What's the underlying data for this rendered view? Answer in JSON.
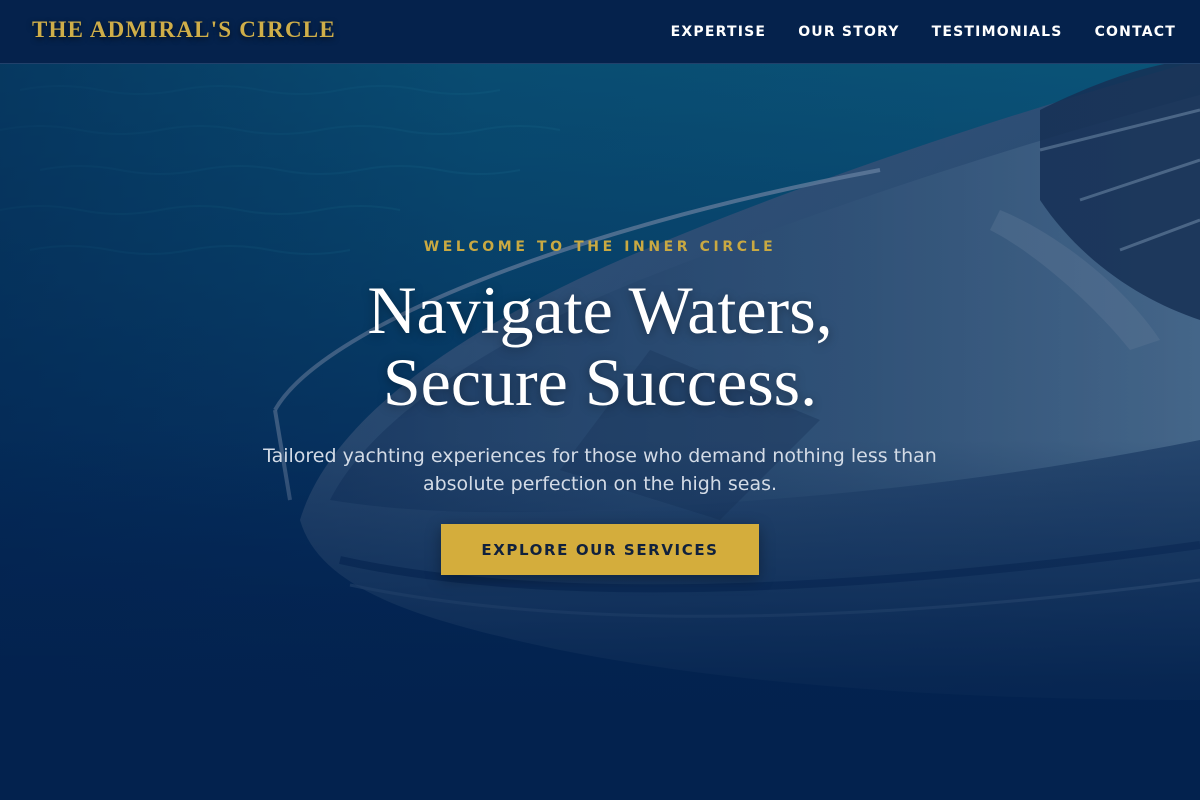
{
  "brand": {
    "name": "THE ADMIRAL'S CIRCLE"
  },
  "nav": {
    "items": [
      {
        "label": "EXPERTISE"
      },
      {
        "label": "OUR STORY"
      },
      {
        "label": "TESTIMONIALS"
      },
      {
        "label": "CONTACT"
      }
    ]
  },
  "hero": {
    "eyebrow": "WELCOME TO THE INNER CIRCLE",
    "headline_line1": "Navigate Waters,",
    "headline_line2": "Secure Success.",
    "subtitle": "Tailored yachting experiences for those who demand nothing less than absolute perfection on the high seas.",
    "cta_label": "EXPLORE OUR SERVICES"
  },
  "colors": {
    "navy": "#03224e",
    "gold": "#d4ad3c",
    "brand_gold": "#cfae49",
    "white": "#ffffff"
  }
}
